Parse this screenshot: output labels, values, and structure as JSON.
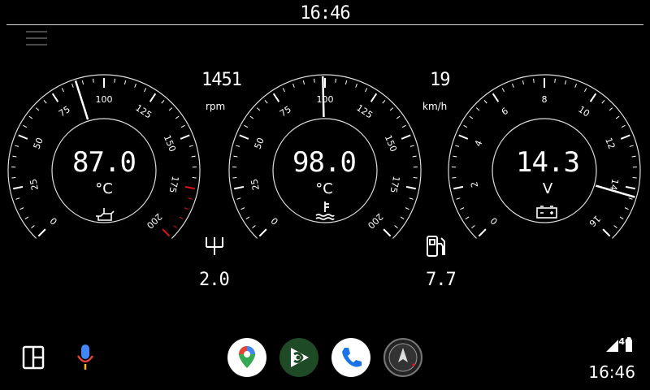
{
  "status_bar": {
    "time": "16:46"
  },
  "gauges": [
    {
      "id": "oil-temp",
      "value": "87.0",
      "unit": "°C",
      "icon": "oil-temperature-icon",
      "min": 0,
      "max": 200,
      "tick_labels": [
        "0",
        "25",
        "50",
        "75",
        "100",
        "125",
        "150",
        "175",
        "200"
      ],
      "needle_value": 87,
      "redline_from": 175
    },
    {
      "id": "coolant-temp",
      "value": "98.0",
      "unit": "°C",
      "icon": "coolant-temperature-icon",
      "min": 0,
      "max": 200,
      "tick_labels": [
        "0",
        "25",
        "50",
        "75",
        "100",
        "125",
        "150",
        "175",
        "200"
      ],
      "needle_value": 99
    },
    {
      "id": "battery-voltage",
      "value": "14.3",
      "unit": "V",
      "icon": "battery-icon",
      "min": 0,
      "max": 16,
      "tick_labels": [
        "0",
        "2",
        "4",
        "6",
        "8",
        "10",
        "12",
        "14",
        "16"
      ],
      "needle_value": 14.3
    }
  ],
  "readouts": {
    "rpm": {
      "value": "1451",
      "unit": "rpm"
    },
    "speed": {
      "value": "19",
      "unit": "km/h"
    },
    "gear": {
      "value": "2.0",
      "icon": "gearshift-icon"
    },
    "fuel": {
      "value": "7.7",
      "icon": "fuel-pump-icon"
    }
  },
  "dock": {
    "apps": [
      "maps-app-icon",
      "play-app-icon",
      "phone-app-icon",
      "gauge-app-icon"
    ],
    "network": "4G",
    "time": "16:46"
  },
  "colors": {
    "redline": "#e01010",
    "accent_blue": "#1a73e8"
  }
}
